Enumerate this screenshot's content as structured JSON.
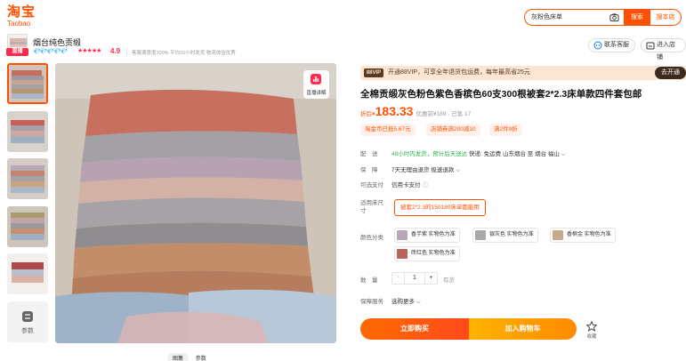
{
  "header": {
    "logo_cn": "淘宝",
    "logo_en": "Taobao",
    "search_value": "灰粉色床单",
    "search_button": "搜索",
    "store_search_button": "搜本店"
  },
  "shop": {
    "name": "烟台纯色贡缎",
    "live_tag": "直播",
    "diamonds": "💎💎💎💎💎",
    "stars": "★★★★★",
    "score": "4.9",
    "meta": "客服满意度100%  平均15小时发货  物流体验优秀",
    "contact": "联系客服",
    "enter_shop": "进入店铺"
  },
  "gallery": {
    "param_label": "参数",
    "live_badge": "直播讲解",
    "tabs": [
      "图集",
      "参数"
    ]
  },
  "product": {
    "vip_tag": "88VIP",
    "vip_text": "开通88VIP，可享全年退货包运费，每年最高省25元",
    "vip_button": "去开通",
    "title": "全棉贡缎灰色粉色紫色香槟色60支300根被套2*2.3床单款四件套包邮",
    "price_prefix": "折后¥",
    "price": "183.33",
    "price_orig": "优惠前¥189 · 已售 17",
    "promos": [
      "淘金币已抵5.67元",
      "店铺券满200减10",
      "满2件9折"
    ],
    "delivery_label": "配　送",
    "delivery_fast": "48小时内发货，预计后天送达",
    "delivery_rest": "快递: 免运费   山东烟台  至  烟台 福山",
    "guarantee_label": "保　障",
    "guarantee_value": "7天无理由退货   极速退款",
    "pay_label": "可选支付",
    "pay_value": "信用卡支付",
    "size_label": "适用床尺寸",
    "size_option": "被套2*2.3的150180床单都能用",
    "color_label": "颜色分类",
    "colors": [
      {
        "label": "香芋紫 实物色为准",
        "swatch": "#b9a6b8"
      },
      {
        "label": "银灰色 实物色为准",
        "swatch": "#a9a7a9"
      },
      {
        "label": "香槟金 实物色为准",
        "swatch": "#c9a98a"
      },
      {
        "label": "砖红色 实物色为准",
        "swatch": "#b9655a"
      }
    ],
    "qty_label": "数　量",
    "qty_value": "1",
    "stock": "有货",
    "service_label": "保障服务",
    "service_value": "选购更多",
    "buy_now": "立即购买",
    "add_cart": "加入购物车",
    "favorite": "收藏"
  },
  "colors": {
    "accent": "#ff5000",
    "cart": "#ff9a00",
    "vip_bg": "#fbe6d3"
  }
}
